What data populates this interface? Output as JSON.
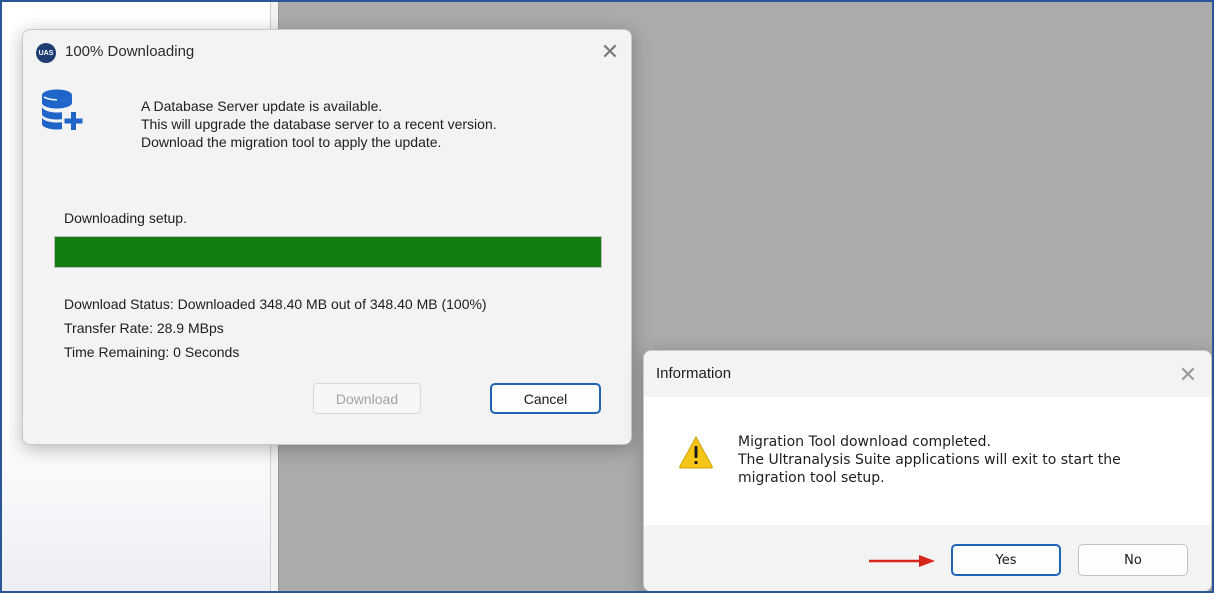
{
  "download_dialog": {
    "title": "100% Downloading",
    "logo_text": "UAS",
    "close_symbol": "✕",
    "message": [
      "A Database Server update is available.",
      "This will upgrade the database server to a recent version.",
      "Download the migration tool to apply the update."
    ],
    "progress_label": "Downloading setup.",
    "progress_percent": 100,
    "status": "Download Status: Downloaded 348.40 MB out of 348.40 MB (100%)",
    "transfer_rate": "Transfer Rate: 28.9 MBps",
    "time_remaining": "Time Remaining: 0 Seconds",
    "download_button": "Download",
    "cancel_button": "Cancel",
    "icon": "database-add-icon"
  },
  "info_dialog": {
    "title": "Information",
    "close_symbol": "✕",
    "icon": "warning-icon",
    "message": [
      "Migration Tool download completed.",
      "The Ultranalysis Suite applications will exit to start the",
      "migration tool setup."
    ],
    "yes_button": "Yes",
    "no_button": "No"
  },
  "colors": {
    "progress_fill": "#117d10",
    "accent_border": "#1e64b4",
    "background_gray": "#ababab",
    "annotation_arrow": "#d9261c"
  }
}
